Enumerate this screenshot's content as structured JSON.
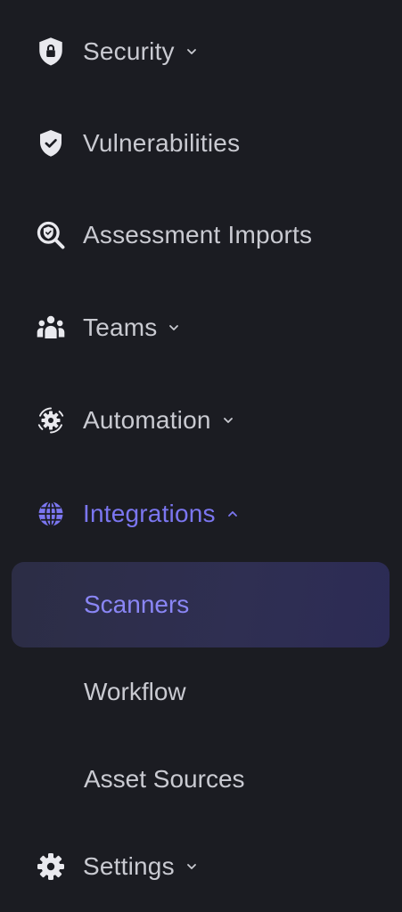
{
  "sidebar": {
    "items": [
      {
        "label": "Security",
        "icon": "lock-shield-icon",
        "expandable": true,
        "expanded": false
      },
      {
        "label": "Vulnerabilities",
        "icon": "shield-check-icon",
        "expandable": false
      },
      {
        "label": "Assessment Imports",
        "icon": "search-shield-icon",
        "expandable": false
      },
      {
        "label": "Teams",
        "icon": "users-icon",
        "expandable": true,
        "expanded": false
      },
      {
        "label": "Automation",
        "icon": "gear-cycle-icon",
        "expandable": true,
        "expanded": false
      },
      {
        "label": "Integrations",
        "icon": "globe-icon",
        "expandable": true,
        "expanded": true,
        "active": true
      },
      {
        "label": "Settings",
        "icon": "gear-icon",
        "expandable": true,
        "expanded": false
      }
    ],
    "integrations_children": [
      {
        "label": "Scanners",
        "selected": true
      },
      {
        "label": "Workflow",
        "selected": false
      },
      {
        "label": "Asset Sources",
        "selected": false
      }
    ]
  },
  "colors": {
    "background": "#1b1c22",
    "text": "#c9cad1",
    "accent": "#7b76f0",
    "selected_bg": "#2e2e4c"
  }
}
